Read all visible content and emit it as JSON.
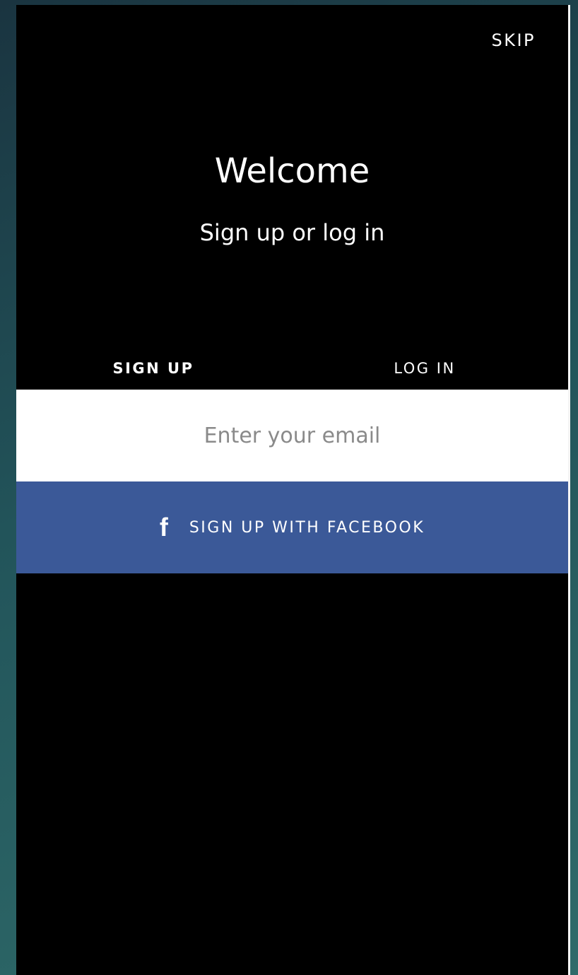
{
  "header": {
    "skip_label": "SKIP"
  },
  "welcome": {
    "title": "Welcome",
    "subtitle": "Sign up or log in"
  },
  "tabs": [
    {
      "label": "SIGN UP",
      "active": true
    },
    {
      "label": "LOG IN",
      "active": false
    }
  ],
  "email": {
    "placeholder": "Enter your email",
    "value": ""
  },
  "facebook": {
    "icon": "facebook-icon",
    "glyph": "f",
    "label": "SIGN UP WITH FACEBOOK",
    "color": "#3b5998"
  },
  "colors": {
    "screen_background": "#000000",
    "text": "#ffffff",
    "facebook_blue": "#3b5998"
  }
}
